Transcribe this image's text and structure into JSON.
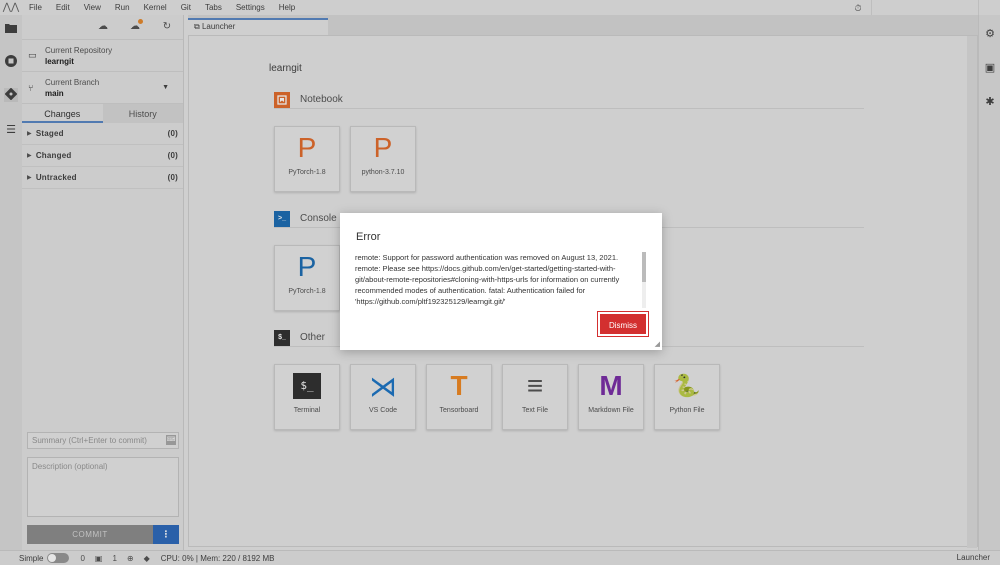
{
  "menu": {
    "logo": "⋀⋀",
    "items": [
      "File",
      "Edit",
      "View",
      "Run",
      "Kernel",
      "Git",
      "Tabs",
      "Settings",
      "Help"
    ]
  },
  "git_panel": {
    "repo_label": "Current Repository",
    "repo_value": "learngit",
    "branch_label": "Current Branch",
    "branch_value": "main",
    "tabs": [
      "Changes",
      "History"
    ],
    "sections": [
      {
        "label": "Staged",
        "count": "(0)"
      },
      {
        "label": "Changed",
        "count": "(0)"
      },
      {
        "label": "Untracked",
        "count": "(0)"
      }
    ],
    "summary_placeholder": "Summary (Ctrl+Enter to commit)",
    "description_placeholder": "Description (optional)",
    "commit_label": "COMMIT",
    "commit_more": "⋮"
  },
  "main": {
    "tab_label": "Launcher",
    "launcher_title": "learngit",
    "sections": {
      "notebook": "Notebook",
      "console": "Console",
      "other": "Other"
    },
    "notebook_cards": [
      {
        "glyph": "P",
        "label": "PyTorch-1.8"
      },
      {
        "glyph": "P",
        "label": "python-3.7.10"
      }
    ],
    "console_cards": [
      {
        "glyph": "P",
        "label": "PyTorch-1.8"
      }
    ],
    "other_cards": [
      {
        "glyph": "$_",
        "label": "Terminal"
      },
      {
        "glyph": "⋊",
        "label": "VS Code"
      },
      {
        "glyph": "T",
        "label": "Tensorboard"
      },
      {
        "glyph": "≡",
        "label": "Text File"
      },
      {
        "glyph": "M",
        "label": "Markdown File"
      },
      {
        "glyph": "🐍",
        "label": "Python File"
      }
    ]
  },
  "dialog": {
    "title": "Error",
    "message": "remote: Support for password authentication was removed on August 13, 2021. remote: Please see https://docs.github.com/en/get-started/getting-started-with-git/about-remote-repositories#cloning-with-https-urls for information on currently recommended modes of authentication. fatal: Authentication failed for 'https://github.com/pltf192325129/learngit.git/'",
    "dismiss_label": "Dismiss"
  },
  "statusbar": {
    "simple_label": "Simple",
    "kernel_count": "0",
    "terminal_count": "1",
    "other_count": "0",
    "resources": "CPU: 0% | Mem: 220 / 8192 MB",
    "right_label": "Launcher"
  },
  "colors": {
    "accent": "#5b88c6",
    "notebook_orange": "#e46e2e",
    "console_blue": "#1f6fb5",
    "dismiss_red": "#d32f2f",
    "commit_more_blue": "#2f6bbd"
  }
}
